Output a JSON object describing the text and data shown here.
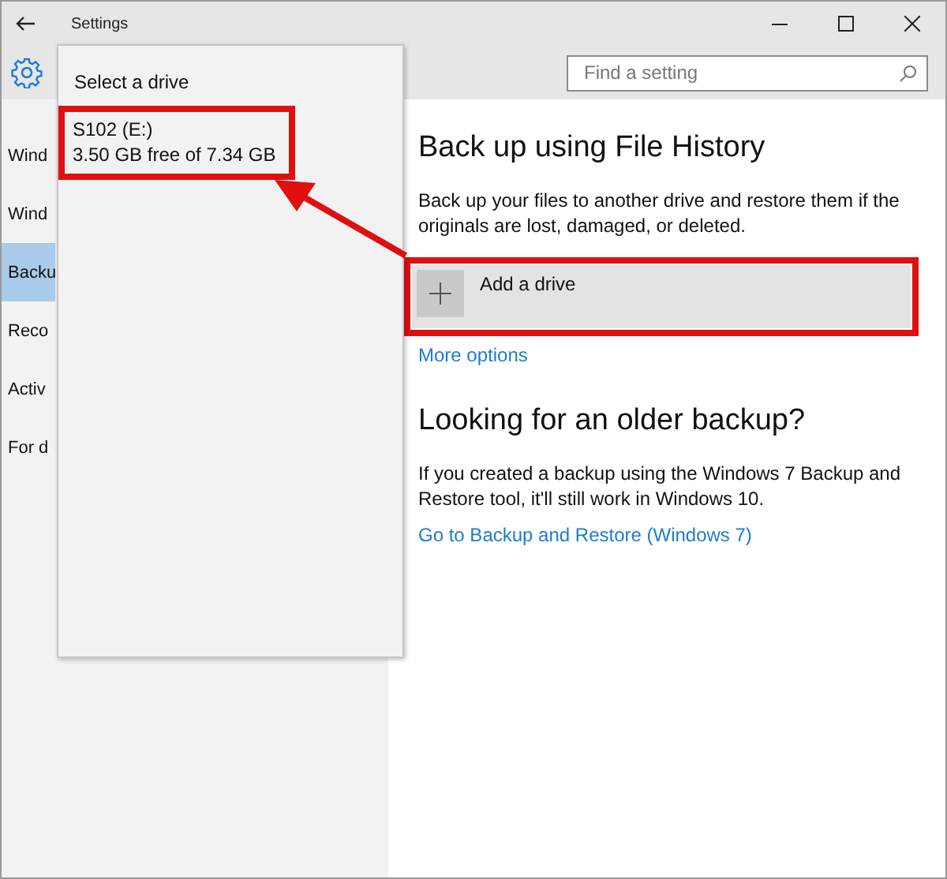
{
  "window": {
    "title": "Settings"
  },
  "search": {
    "placeholder": "Find a setting"
  },
  "sidebar": {
    "items": [
      {
        "label": "Wind",
        "selected": false
      },
      {
        "label": "Wind",
        "selected": false
      },
      {
        "label": "Backu",
        "selected": true
      },
      {
        "label": "Reco",
        "selected": false
      },
      {
        "label": "Activ",
        "selected": false
      },
      {
        "label": "For d",
        "selected": false
      }
    ]
  },
  "flyout": {
    "title": "Select a drive",
    "drives": [
      {
        "name": "S102 (E:)",
        "space": "3.50 GB free of 7.34 GB"
      }
    ]
  },
  "content": {
    "heading": "Back up using File History",
    "description": "Back up your files to another drive and restore them if the originals are lost, damaged, or deleted.",
    "add_drive": "Add a drive",
    "more_options": "More options",
    "older_heading": "Looking for an older backup?",
    "older_description": "If you created a backup using the Windows 7 Backup and Restore tool, it'll still work in Windows 10.",
    "older_link": "Go to Backup and Restore (Windows 7)"
  }
}
